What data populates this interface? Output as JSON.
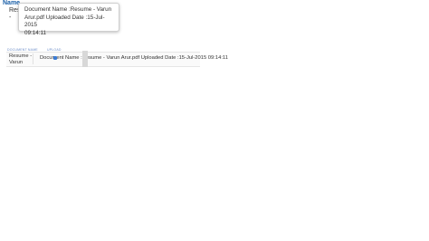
{
  "grid_top": {
    "column_header": "Name",
    "cell_line1": "Resu",
    "cell_line2": "-"
  },
  "tooltip": {
    "line1": "Document Name :Resume - Varun",
    "line2": "Arur.pdf Uploaded Date :15-Jul-2015",
    "line3": "09:14:11"
  },
  "grid_row": {
    "label_left": "DOCUMENT NAME",
    "label_right": "UPLOAD",
    "name_line1": "Resume -",
    "name_line2": "Varun",
    "description": "Document Name :Resume - Varun Arur.pdf Uploaded Date :15-Jul-2015 09:14:11"
  },
  "accent_color": "#1a5fa8"
}
